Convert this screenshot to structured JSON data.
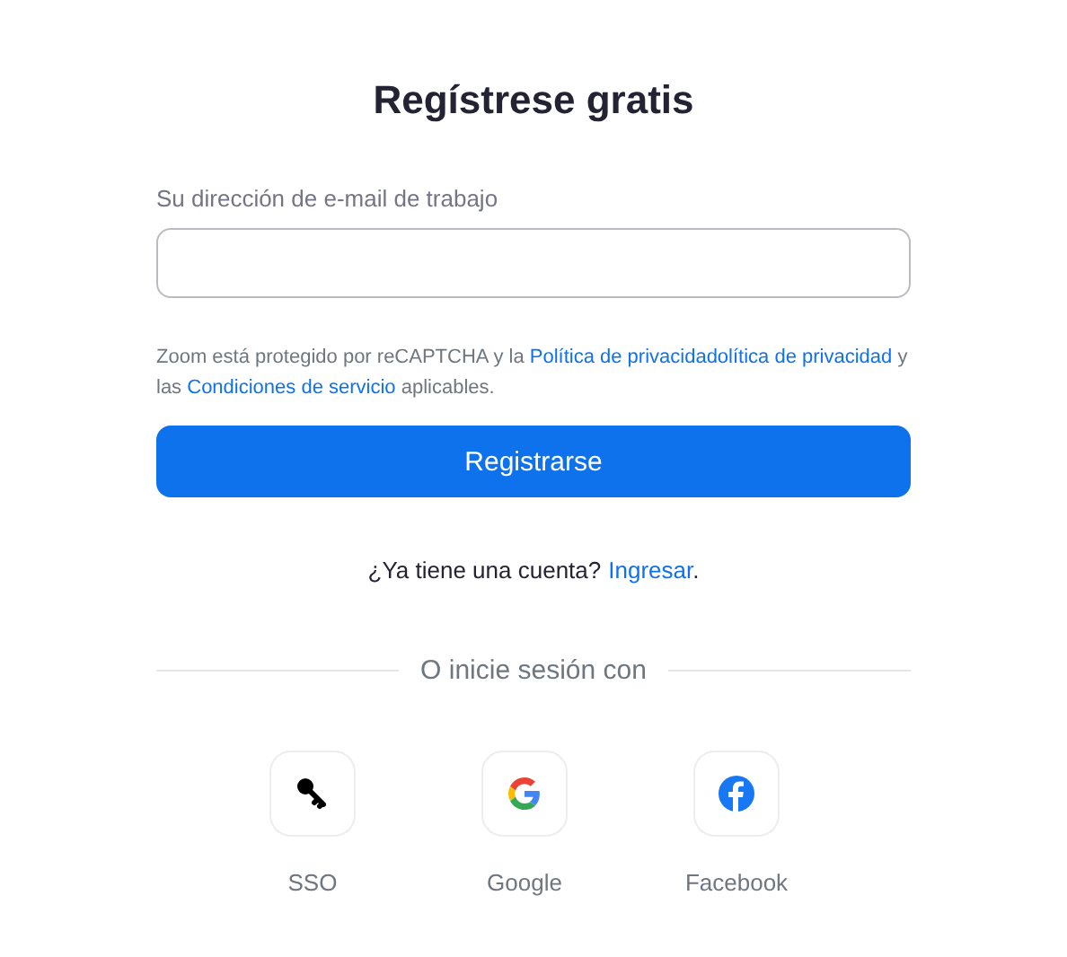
{
  "title": "Regístrese gratis",
  "email": {
    "label": "Su dirección de e-mail de trabajo"
  },
  "notice": {
    "parts": [
      {
        "kind": "text",
        "text": "Zoom está protegido por reCAPTCHA y la "
      },
      {
        "kind": "link",
        "text": "Política de privacidadolítica de privacidad"
      },
      {
        "kind": "text",
        "text": " y las "
      },
      {
        "kind": "link",
        "text": "Condiciones de servicio"
      },
      {
        "kind": "text",
        "text": " aplicables."
      }
    ]
  },
  "submit": "Registrarse",
  "account": {
    "question": "¿Ya tiene una cuenta?",
    "link": "Ingresar",
    "end": "."
  },
  "divider": "O inicie sesión con",
  "providers": [
    {
      "kind": "key",
      "label": "SSO"
    },
    {
      "kind": "google",
      "label": "Google"
    },
    {
      "kind": "facebook",
      "label": "Facebook"
    }
  ]
}
